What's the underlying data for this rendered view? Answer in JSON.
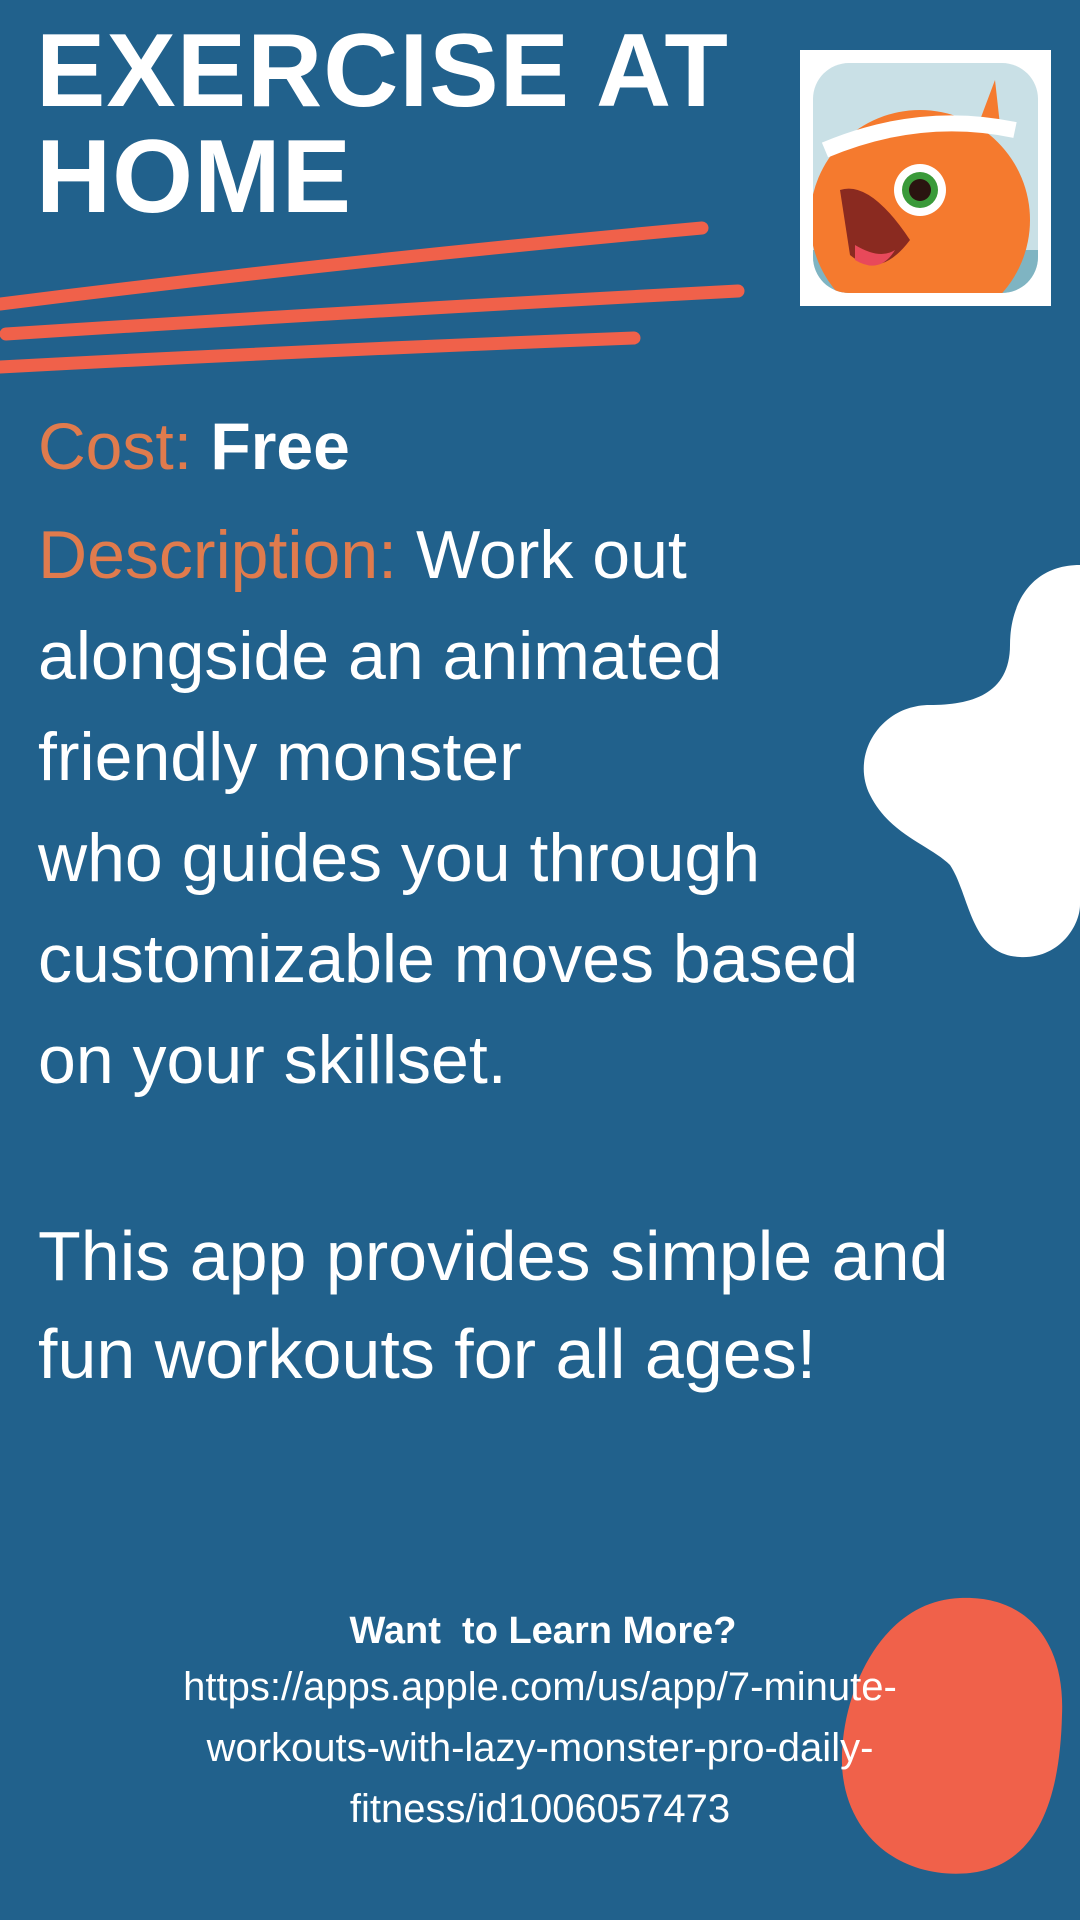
{
  "header": {
    "title_lines": [
      "EXERCISE AT",
      "HOME"
    ],
    "app_icon": "lazy-monster-app-icon"
  },
  "cost": {
    "label": "Cost:",
    "value": "Free"
  },
  "description": {
    "label": "Description:",
    "first_line_rest": "Work out",
    "lines": [
      "alongside an animated",
      "friendly monster",
      "who guides you through",
      "customizable moves based",
      "on your skillset."
    ]
  },
  "extra": {
    "lines": [
      "This app provides simple and",
      "fun workouts for all ages!"
    ]
  },
  "learn_more": {
    "heading": "Want  to Learn More?",
    "url_lines": [
      "https://apps.apple.com/us/app/7-minute-",
      "workouts-with-lazy-monster-pro-daily-",
      "fitness/id1006057473"
    ]
  },
  "colors": {
    "background": "#21618c",
    "label": "#e07b4d",
    "accent": "#f0614a"
  }
}
